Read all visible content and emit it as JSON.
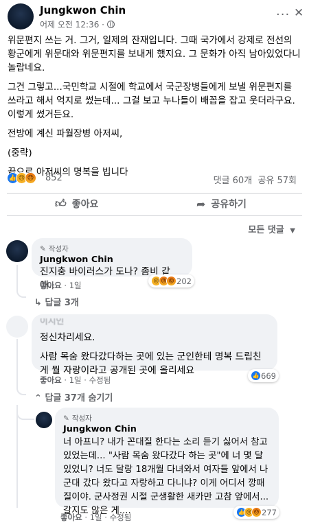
{
  "post": {
    "author": "Jungkwon Chin",
    "time": "어제 오전 12:36 ·",
    "more_label": "···",
    "close_label": "✕",
    "paragraphs": [
      "위문편지 쓰는 거. 그거, 일제의 잔재입니다. 그때 국가에서 강제로 전선의 황군에게 위문대와 위문편지를 보내게 했지요. 그 문화가 아직 남아있었다니 놀랍네요.",
      "그건 그렇고...국민학교 시절에 학교에서 국군장병들에게 보낼 위문편지를 쓰라고 해서 억지로 썼는데... 그걸 보고 누나들이 배꼽을 잡고 웃더라구요. 이렇게 썼거든요.",
      "전방에 계신 파월장병 아저씨,",
      "(중략)",
      "끝으로 아저씨의 명복을 빕니다"
    ],
    "reaction_count": "852",
    "comment_count": "댓글 60개",
    "share_count": "공유 57회"
  },
  "actions": {
    "like": "좋아요",
    "share": "공유하기"
  },
  "sort_label": "모든 댓글",
  "comments": [
    {
      "badge": "작성자",
      "author": "Jungkwon Chin",
      "text": "진지충 바이러스가 도나? 좀비 같애..",
      "like": "좋아요",
      "age": "1일",
      "reactions": "202",
      "replies": "답글 3개"
    },
    {
      "author": "이지인",
      "text1": "정신차리세요.",
      "text2": "사람 목숨 왔다갔다하는 곳에 있는 군인한테 명복 드립친게 뭘 자랑이라고 공개된 곳에 올리세요",
      "like": "좋아요",
      "age": "1일",
      "edited": "수정됨",
      "reactions": "669",
      "replies": "답글 37개 숨기기"
    },
    {
      "badge": "작성자",
      "author": "Jungkwon Chin",
      "text": "너 아프니? 내가 꼰대질 한다는 소리 듣기 싫어서 참고 있었는데... \"사람 목숨 왔다갔다 하는 곳\"에 너 몇 달 있었니? 너도 달랑 18개월 다녀와서 여자들 앞에서 나 군대 갔다 왔다고 자랑하고 다니냐? 이게 어디서 깡패질이야. 군사정권 시절 군생활한 새카만 고참 앞에서... 갈지도 않은 게....",
      "like": "좋아요",
      "age": "1일",
      "edited": "수정됨",
      "reactions": "277"
    }
  ]
}
